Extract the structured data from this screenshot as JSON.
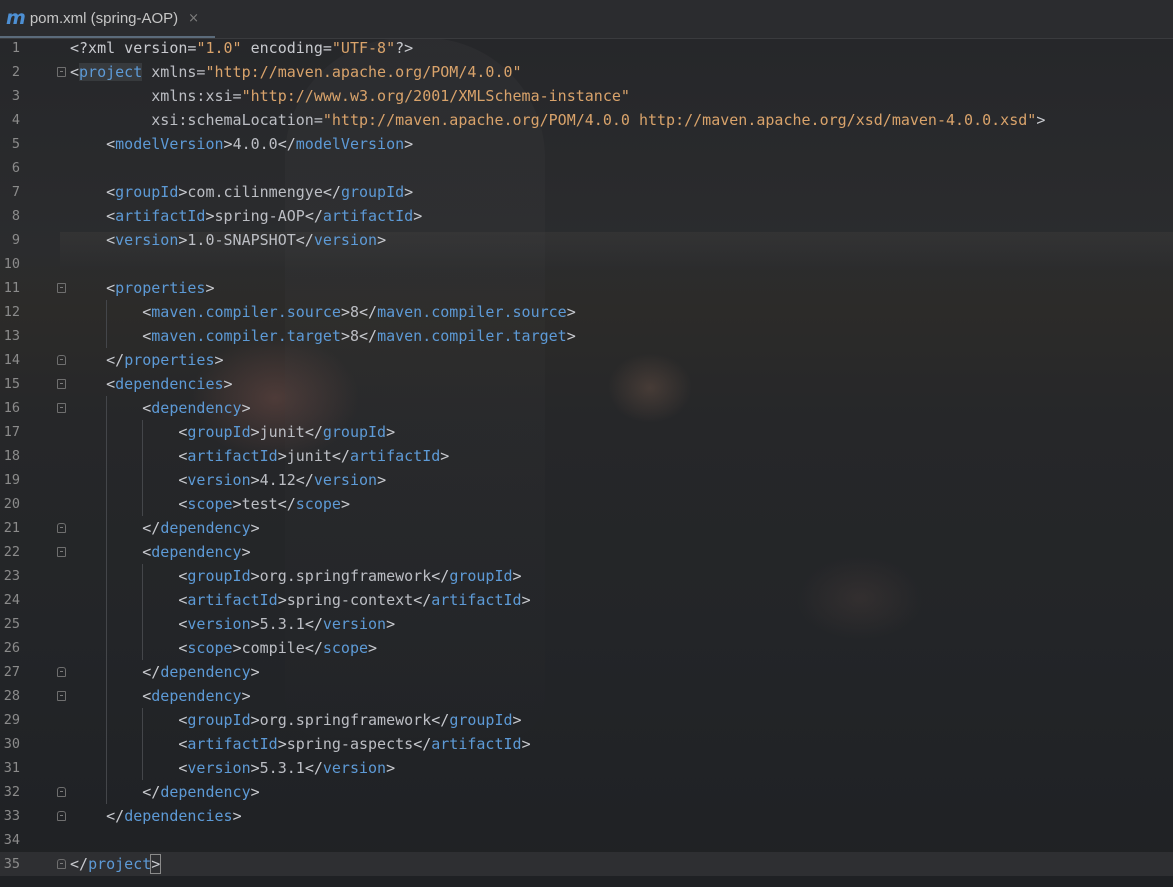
{
  "tab": {
    "icon": "m",
    "title": "pom.xml (spring-AOP)",
    "close": "×"
  },
  "editor": {
    "current_line": 35,
    "lines": [
      {
        "n": "1",
        "tokens": [
          [
            "b",
            "<?xml version="
          ],
          [
            "s",
            "\"1.0\""
          ],
          [
            "b",
            " encoding="
          ],
          [
            "s",
            "\"UTF-8\""
          ],
          [
            "b",
            "?>"
          ]
        ]
      },
      {
        "n": "2",
        "fold": "start",
        "tokens": [
          [
            "b",
            "<"
          ],
          [
            "t",
            "project"
          ],
          [
            "a",
            " xmlns="
          ],
          [
            "s",
            "\"http://maven.apache.org/POM/4.0.0\""
          ]
        ]
      },
      {
        "n": "3",
        "tokens": [
          [
            "a",
            "         xmlns:xsi="
          ],
          [
            "s",
            "\"http://www.w3.org/2001/XMLSchema-instance\""
          ]
        ]
      },
      {
        "n": "4",
        "tokens": [
          [
            "a",
            "         xsi:schemaLocation="
          ],
          [
            "s",
            "\"http://maven.apache.org/POM/4.0.0 http://maven.apache.org/xsd/maven-4.0.0.xsd\""
          ],
          [
            "b",
            ">"
          ]
        ]
      },
      {
        "n": "5",
        "tokens": [
          [
            "b",
            "    <"
          ],
          [
            "t",
            "modelVersion"
          ],
          [
            "b",
            ">"
          ],
          [
            "x",
            "4.0.0"
          ],
          [
            "b",
            "</"
          ],
          [
            "t",
            "modelVersion"
          ],
          [
            "b",
            ">"
          ]
        ]
      },
      {
        "n": "6",
        "tokens": []
      },
      {
        "n": "7",
        "tokens": [
          [
            "b",
            "    <"
          ],
          [
            "t",
            "groupId"
          ],
          [
            "b",
            ">"
          ],
          [
            "x",
            "com.cilinmengye"
          ],
          [
            "b",
            "</"
          ],
          [
            "t",
            "groupId"
          ],
          [
            "b",
            ">"
          ]
        ]
      },
      {
        "n": "8",
        "tokens": [
          [
            "b",
            "    <"
          ],
          [
            "t",
            "artifactId"
          ],
          [
            "b",
            ">"
          ],
          [
            "x",
            "spring-AOP"
          ],
          [
            "b",
            "</"
          ],
          [
            "t",
            "artifactId"
          ],
          [
            "b",
            ">"
          ]
        ]
      },
      {
        "n": "9",
        "tokens": [
          [
            "b",
            "    <"
          ],
          [
            "t",
            "version"
          ],
          [
            "b",
            ">"
          ],
          [
            "x",
            "1.0-SNAPSHOT"
          ],
          [
            "b",
            "</"
          ],
          [
            "t",
            "version"
          ],
          [
            "b",
            ">"
          ]
        ]
      },
      {
        "n": "10",
        "tokens": []
      },
      {
        "n": "11",
        "fold": "start",
        "tokens": [
          [
            "b",
            "    <"
          ],
          [
            "t",
            "properties"
          ],
          [
            "b",
            ">"
          ]
        ]
      },
      {
        "n": "12",
        "tokens": [
          [
            "b",
            "        <"
          ],
          [
            "t",
            "maven.compiler.source"
          ],
          [
            "b",
            ">"
          ],
          [
            "x",
            "8"
          ],
          [
            "b",
            "</"
          ],
          [
            "t",
            "maven.compiler.source"
          ],
          [
            "b",
            ">"
          ]
        ]
      },
      {
        "n": "13",
        "tokens": [
          [
            "b",
            "        <"
          ],
          [
            "t",
            "maven.compiler.target"
          ],
          [
            "b",
            ">"
          ],
          [
            "x",
            "8"
          ],
          [
            "b",
            "</"
          ],
          [
            "t",
            "maven.compiler.target"
          ],
          [
            "b",
            ">"
          ]
        ]
      },
      {
        "n": "14",
        "fold": "end",
        "tokens": [
          [
            "b",
            "    </"
          ],
          [
            "t",
            "properties"
          ],
          [
            "b",
            ">"
          ]
        ]
      },
      {
        "n": "15",
        "fold": "start",
        "tokens": [
          [
            "b",
            "    <"
          ],
          [
            "t",
            "dependencies"
          ],
          [
            "b",
            ">"
          ]
        ]
      },
      {
        "n": "16",
        "fold": "start",
        "tokens": [
          [
            "b",
            "        <"
          ],
          [
            "t",
            "dependency"
          ],
          [
            "b",
            ">"
          ]
        ]
      },
      {
        "n": "17",
        "tokens": [
          [
            "b",
            "            <"
          ],
          [
            "t",
            "groupId"
          ],
          [
            "b",
            ">"
          ],
          [
            "x",
            "junit"
          ],
          [
            "b",
            "</"
          ],
          [
            "t",
            "groupId"
          ],
          [
            "b",
            ">"
          ]
        ]
      },
      {
        "n": "18",
        "tokens": [
          [
            "b",
            "            <"
          ],
          [
            "t",
            "artifactId"
          ],
          [
            "b",
            ">"
          ],
          [
            "x",
            "junit"
          ],
          [
            "b",
            "</"
          ],
          [
            "t",
            "artifactId"
          ],
          [
            "b",
            ">"
          ]
        ]
      },
      {
        "n": "19",
        "tokens": [
          [
            "b",
            "            <"
          ],
          [
            "t",
            "version"
          ],
          [
            "b",
            ">"
          ],
          [
            "x",
            "4.12"
          ],
          [
            "b",
            "</"
          ],
          [
            "t",
            "version"
          ],
          [
            "b",
            ">"
          ]
        ]
      },
      {
        "n": "20",
        "tokens": [
          [
            "b",
            "            <"
          ],
          [
            "t",
            "scope"
          ],
          [
            "b",
            ">"
          ],
          [
            "x",
            "test"
          ],
          [
            "b",
            "</"
          ],
          [
            "t",
            "scope"
          ],
          [
            "b",
            ">"
          ]
        ]
      },
      {
        "n": "21",
        "fold": "end",
        "tokens": [
          [
            "b",
            "        </"
          ],
          [
            "t",
            "dependency"
          ],
          [
            "b",
            ">"
          ]
        ]
      },
      {
        "n": "22",
        "fold": "start",
        "tokens": [
          [
            "b",
            "        <"
          ],
          [
            "t",
            "dependency"
          ],
          [
            "b",
            ">"
          ]
        ]
      },
      {
        "n": "23",
        "tokens": [
          [
            "b",
            "            <"
          ],
          [
            "t",
            "groupId"
          ],
          [
            "b",
            ">"
          ],
          [
            "x",
            "org.springframework"
          ],
          [
            "b",
            "</"
          ],
          [
            "t",
            "groupId"
          ],
          [
            "b",
            ">"
          ]
        ]
      },
      {
        "n": "24",
        "tokens": [
          [
            "b",
            "            <"
          ],
          [
            "t",
            "artifactId"
          ],
          [
            "b",
            ">"
          ],
          [
            "x",
            "spring-context"
          ],
          [
            "b",
            "</"
          ],
          [
            "t",
            "artifactId"
          ],
          [
            "b",
            ">"
          ]
        ]
      },
      {
        "n": "25",
        "tokens": [
          [
            "b",
            "            <"
          ],
          [
            "t",
            "version"
          ],
          [
            "b",
            ">"
          ],
          [
            "x",
            "5.3.1"
          ],
          [
            "b",
            "</"
          ],
          [
            "t",
            "version"
          ],
          [
            "b",
            ">"
          ]
        ]
      },
      {
        "n": "26",
        "tokens": [
          [
            "b",
            "            <"
          ],
          [
            "t",
            "scope"
          ],
          [
            "b",
            ">"
          ],
          [
            "x",
            "compile"
          ],
          [
            "b",
            "</"
          ],
          [
            "t",
            "scope"
          ],
          [
            "b",
            ">"
          ]
        ]
      },
      {
        "n": "27",
        "fold": "end",
        "tokens": [
          [
            "b",
            "        </"
          ],
          [
            "t",
            "dependency"
          ],
          [
            "b",
            ">"
          ]
        ]
      },
      {
        "n": "28",
        "fold": "start",
        "tokens": [
          [
            "b",
            "        <"
          ],
          [
            "t",
            "dependency"
          ],
          [
            "b",
            ">"
          ]
        ]
      },
      {
        "n": "29",
        "tokens": [
          [
            "b",
            "            <"
          ],
          [
            "t",
            "groupId"
          ],
          [
            "b",
            ">"
          ],
          [
            "x",
            "org.springframework"
          ],
          [
            "b",
            "</"
          ],
          [
            "t",
            "groupId"
          ],
          [
            "b",
            ">"
          ]
        ]
      },
      {
        "n": "30",
        "tokens": [
          [
            "b",
            "            <"
          ],
          [
            "t",
            "artifactId"
          ],
          [
            "b",
            ">"
          ],
          [
            "x",
            "spring-aspects"
          ],
          [
            "b",
            "</"
          ],
          [
            "t",
            "artifactId"
          ],
          [
            "b",
            ">"
          ]
        ]
      },
      {
        "n": "31",
        "tokens": [
          [
            "b",
            "            <"
          ],
          [
            "t",
            "version"
          ],
          [
            "b",
            ">"
          ],
          [
            "x",
            "5.3.1"
          ],
          [
            "b",
            "</"
          ],
          [
            "t",
            "version"
          ],
          [
            "b",
            ">"
          ]
        ]
      },
      {
        "n": "32",
        "fold": "end",
        "tokens": [
          [
            "b",
            "        </"
          ],
          [
            "t",
            "dependency"
          ],
          [
            "b",
            ">"
          ]
        ]
      },
      {
        "n": "33",
        "fold": "end",
        "tokens": [
          [
            "b",
            "    </"
          ],
          [
            "t",
            "dependencies"
          ],
          [
            "b",
            ">"
          ]
        ]
      },
      {
        "n": "34",
        "tokens": []
      },
      {
        "n": "35",
        "fold": "end",
        "tokens": [
          [
            "b",
            "</"
          ],
          [
            "t",
            "project"
          ],
          [
            "b",
            ">"
          ]
        ]
      }
    ]
  },
  "colors": {
    "tag": "#5d9ad6",
    "string": "#d9a36b",
    "text": "#bcbec4",
    "line_number": "#8b8b8b"
  }
}
